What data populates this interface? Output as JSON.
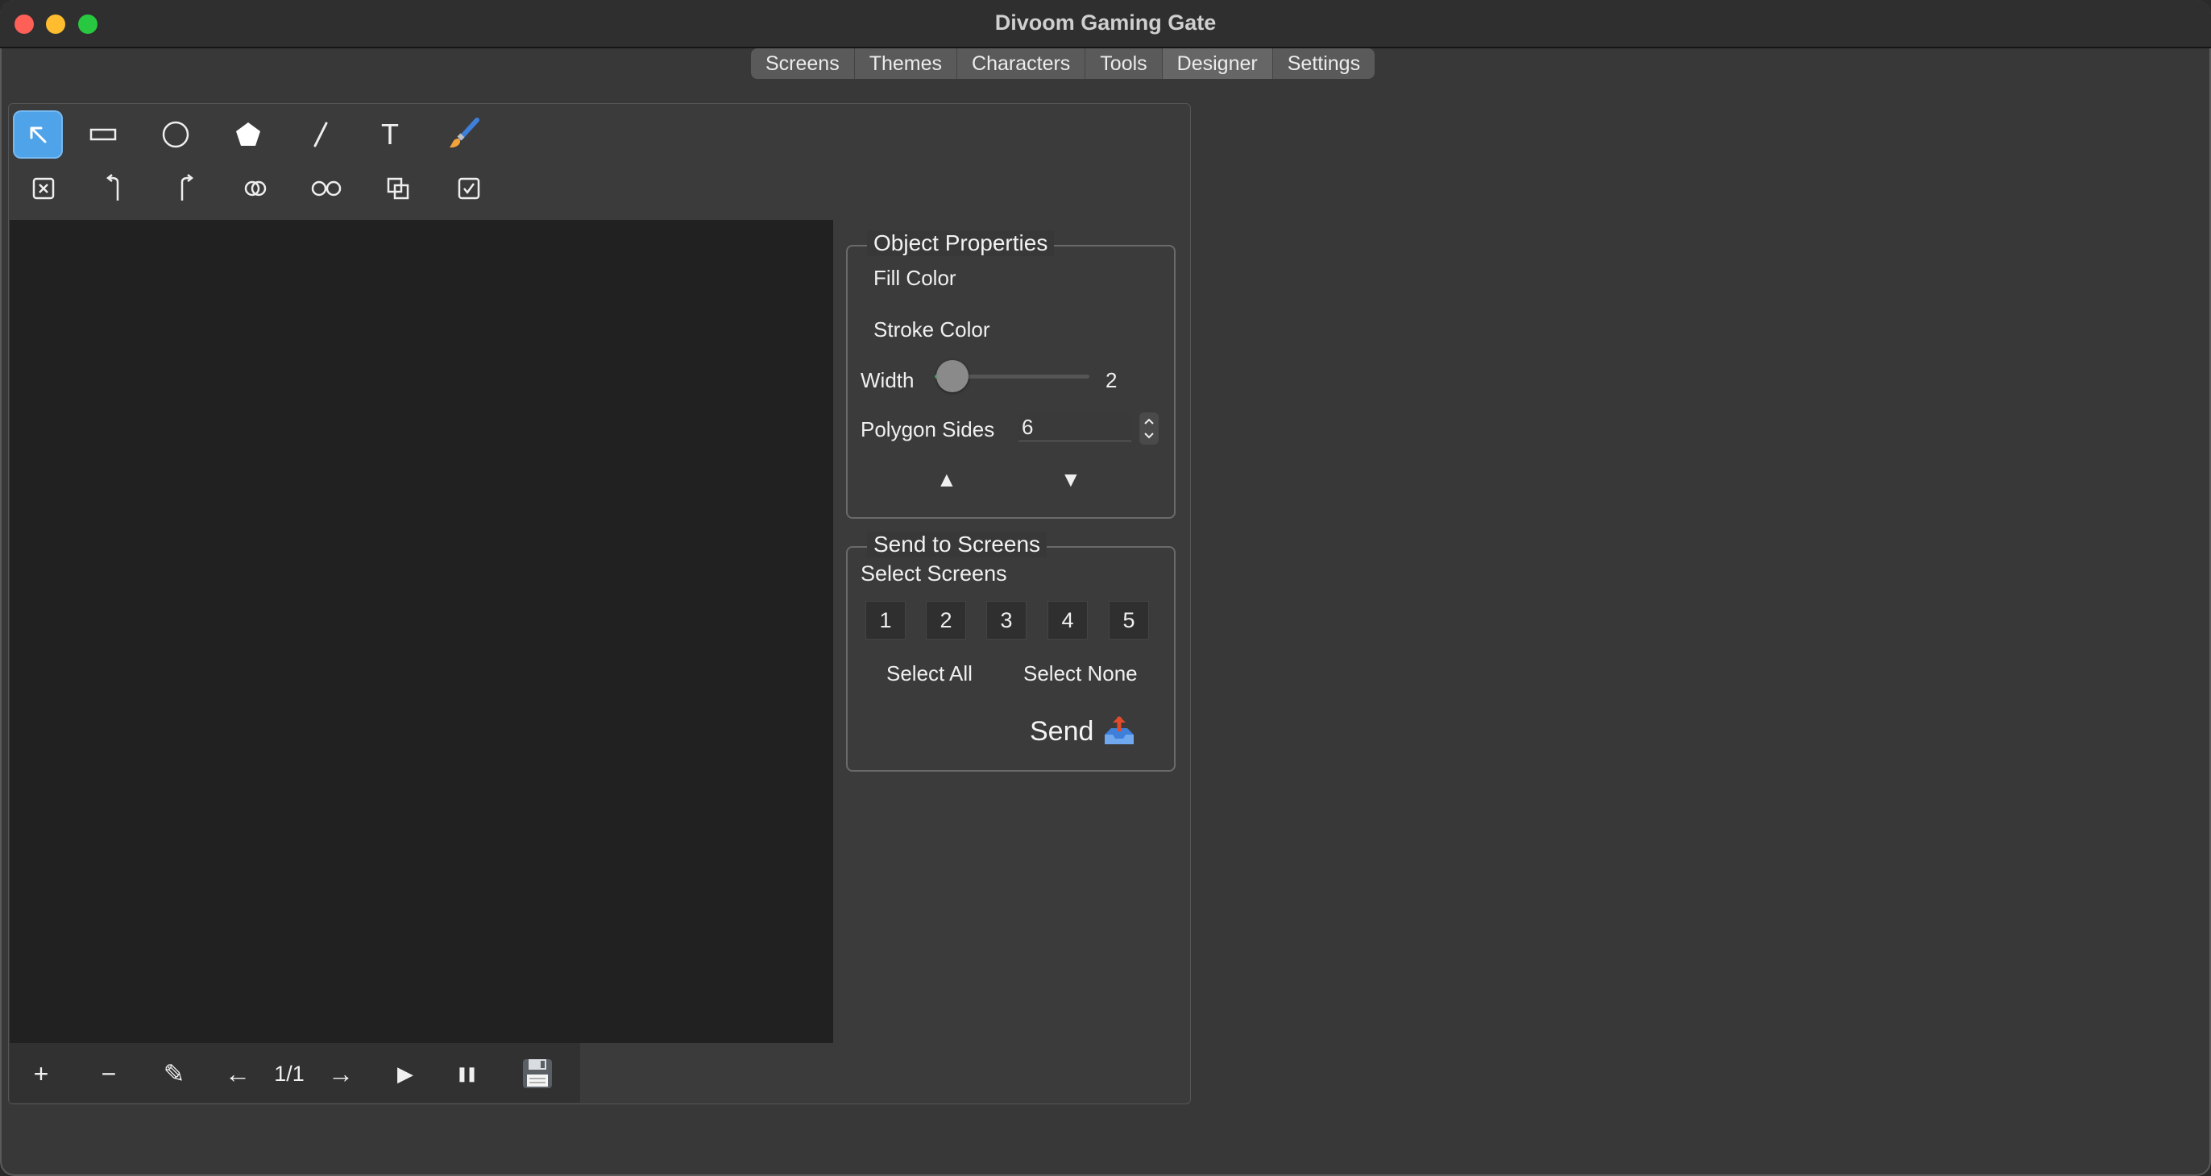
{
  "window": {
    "title": "Divoom Gaming Gate"
  },
  "tabs": [
    {
      "label": "Screens"
    },
    {
      "label": "Themes"
    },
    {
      "label": "Characters"
    },
    {
      "label": "Tools"
    },
    {
      "label": "Designer"
    },
    {
      "label": "Settings"
    }
  ],
  "toolbar": {
    "text_tool_glyph": "T"
  },
  "bottombar": {
    "add_glyph": "+",
    "remove_glyph": "−",
    "edit_glyph": "✎",
    "prev_glyph": "←",
    "page_indicator": "1/1",
    "next_glyph": "→",
    "play_glyph": "▶",
    "pause_glyph": "❚❚"
  },
  "object_properties": {
    "title": "Object Properties",
    "fill_color_label": "Fill Color",
    "stroke_color_label": "Stroke Color",
    "width_label": "Width",
    "width_value": "2",
    "width_slider_fraction": 0.08,
    "polygon_sides_label": "Polygon Sides",
    "polygon_sides_value": "6",
    "bring_forward_glyph": "▲",
    "send_backward_glyph": "▼"
  },
  "send_to_screens": {
    "title": "Send to Screens",
    "select_screens_label": "Select Screens",
    "screens": [
      "1",
      "2",
      "3",
      "4",
      "5"
    ],
    "select_all_label": "Select All",
    "select_none_label": "Select None",
    "send_label": "Send"
  }
}
